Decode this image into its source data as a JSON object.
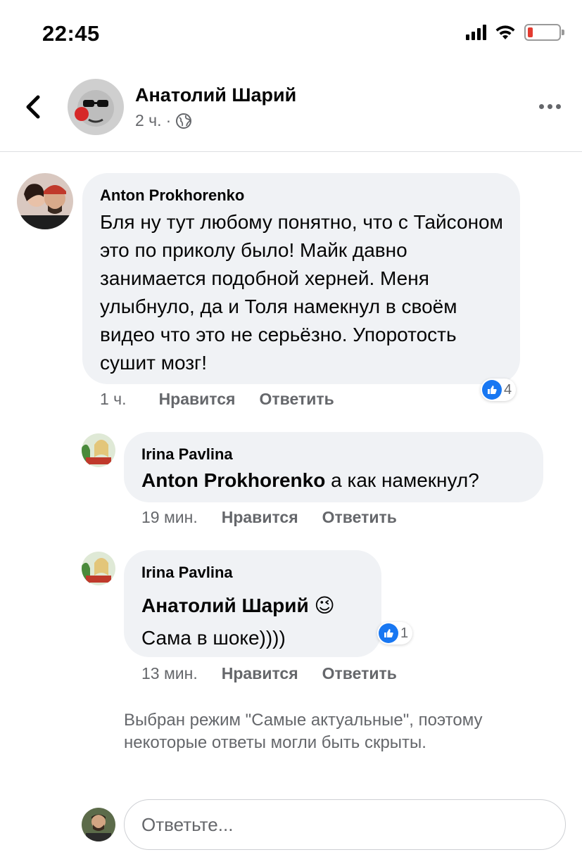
{
  "status_bar": {
    "time": "22:45",
    "battery_color": "#e33b30"
  },
  "post_header": {
    "author": "Анатолий Шарий",
    "time": "2 ч.",
    "separator": "·",
    "privacy_icon": "globe-icon"
  },
  "comments": [
    {
      "author": "Anton Prokhorenko",
      "text": "Бля ну тут любому понятно, что с Тайсоном это по приколу было! Майк давно занимается подобной херней. Меня улыбнуло, да и Толя намекнул в своём видео что это не серьёзно. Упоротость сушит мозг!",
      "time": "1 ч.",
      "like_label": "Нравится",
      "reply_label": "Ответить",
      "reaction_count": "4",
      "replies": [
        {
          "author": "Irina Pavlina",
          "mention": "Anton Prokhorenko",
          "text": "а как намекнул?",
          "time": "19 мин.",
          "like_label": "Нравится",
          "reply_label": "Ответить"
        },
        {
          "author": "Irina Pavlina",
          "mention": "Анатолий Шарий",
          "emoji": "😉",
          "text": "Сама в шоке))))",
          "time": "13 мин.",
          "like_label": "Нравится",
          "reply_label": "Ответить",
          "reaction_count": "1"
        }
      ]
    }
  ],
  "filter_note": "Выбран режим \"Самые актуальные\", поэтому некоторые ответы могли быть скрыты.",
  "reply_box": {
    "placeholder": "Ответьте..."
  },
  "colors": {
    "accent": "#1877f2",
    "bubble": "#f0f2f5",
    "meta_text": "#65676b"
  }
}
